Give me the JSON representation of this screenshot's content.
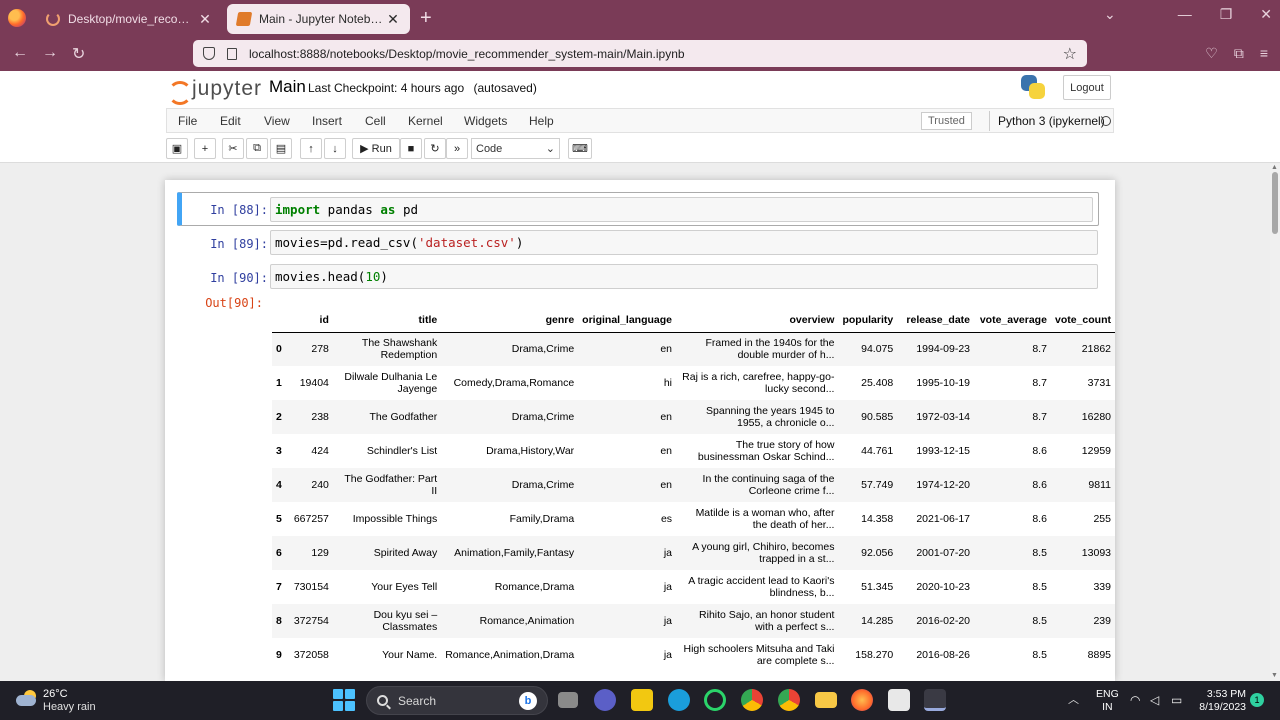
{
  "browser": {
    "tabs": [
      {
        "title": "Desktop/movie_recommender_system-main/",
        "active": false
      },
      {
        "title": "Main - Jupyter Notebook",
        "active": true
      }
    ],
    "url": "localhost:8888/notebooks/Desktop/movie_recommender_system-main/Main.ipynb"
  },
  "jupyter": {
    "logo_text": "jupyter",
    "notebook_name": "Main",
    "checkpoint_label": "Last Checkpoint:",
    "checkpoint_time": "4 hours ago",
    "autosaved": "(autosaved)",
    "logout_label": "Logout",
    "menu": [
      "File",
      "Edit",
      "View",
      "Insert",
      "Cell",
      "Kernel",
      "Widgets",
      "Help"
    ],
    "trusted_label": "Trusted",
    "kernel_name": "Python 3 (ipykernel)",
    "toolbar": {
      "run_label": "Run",
      "cell_type": "Code"
    }
  },
  "cells": [
    {
      "prompt": "In [88]:",
      "code": "import pandas as pd"
    },
    {
      "prompt": "In [89]:",
      "code": "movies=pd.read_csv('dataset.csv')"
    },
    {
      "prompt": "In [90]:",
      "code": "movies.head(10)"
    },
    {
      "prompt": "Out[90]:"
    }
  ],
  "table": {
    "columns": [
      "",
      "id",
      "title",
      "genre",
      "original_language",
      "overview",
      "popularity",
      "release_date",
      "vote_average",
      "vote_count"
    ],
    "rows": [
      [
        "0",
        "278",
        "The Shawshank Redemption",
        "Drama,Crime",
        "en",
        "Framed in the 1940s for the double murder of h...",
        "94.075",
        "1994-09-23",
        "8.7",
        "21862"
      ],
      [
        "1",
        "19404",
        "Dilwale Dulhania Le Jayenge",
        "Comedy,Drama,Romance",
        "hi",
        "Raj is a rich, carefree, happy-go-lucky second...",
        "25.408",
        "1995-10-19",
        "8.7",
        "3731"
      ],
      [
        "2",
        "238",
        "The Godfather",
        "Drama,Crime",
        "en",
        "Spanning the years 1945 to 1955, a chronicle o...",
        "90.585",
        "1972-03-14",
        "8.7",
        "16280"
      ],
      [
        "3",
        "424",
        "Schindler's List",
        "Drama,History,War",
        "en",
        "The true story of how businessman Oskar Schind...",
        "44.761",
        "1993-12-15",
        "8.6",
        "12959"
      ],
      [
        "4",
        "240",
        "The Godfather: Part II",
        "Drama,Crime",
        "en",
        "In the continuing saga of the Corleone crime f...",
        "57.749",
        "1974-12-20",
        "8.6",
        "9811"
      ],
      [
        "5",
        "667257",
        "Impossible Things",
        "Family,Drama",
        "es",
        "Matilde is a woman who, after the death of her...",
        "14.358",
        "2021-06-17",
        "8.6",
        "255"
      ],
      [
        "6",
        "129",
        "Spirited Away",
        "Animation,Family,Fantasy",
        "ja",
        "A young girl, Chihiro, becomes trapped in a st...",
        "92.056",
        "2001-07-20",
        "8.5",
        "13093"
      ],
      [
        "7",
        "730154",
        "Your Eyes Tell",
        "Romance,Drama",
        "ja",
        "A tragic accident lead to Kaori's blindness, b...",
        "51.345",
        "2020-10-23",
        "8.5",
        "339"
      ],
      [
        "8",
        "372754",
        "Dou kyu sei – Classmates",
        "Romance,Animation",
        "ja",
        "Rihito Sajo, an honor student with a perfect s...",
        "14.285",
        "2016-02-20",
        "8.5",
        "239"
      ],
      [
        "9",
        "372058",
        "Your Name.",
        "Romance,Animation,Drama",
        "ja",
        "High schoolers Mitsuha and Taki are complete s...",
        "158.270",
        "2016-08-26",
        "8.5",
        "8895"
      ]
    ]
  },
  "taskbar": {
    "temperature": "26°C",
    "weather": "Heavy rain",
    "search_label": "Search",
    "lang_line1": "ENG",
    "lang_line2": "IN",
    "time": "3:53 PM",
    "date": "8/19/2023",
    "notification_count": "1"
  }
}
